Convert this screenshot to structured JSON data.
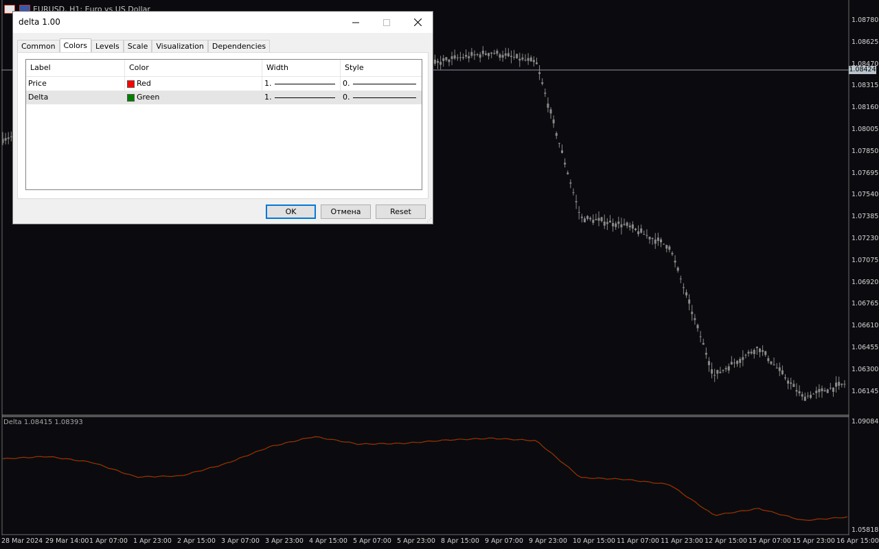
{
  "chart": {
    "symbol_title": "EURUSD, H1:  Euro vs US Dollar",
    "indicator_title": "Delta 1.08415 1.08393",
    "current_price": "1.08424",
    "price_axis": [
      "1.08780",
      "1.08625",
      "1.08470",
      "1.08315",
      "1.08160",
      "1.08005",
      "1.07850",
      "1.07695",
      "1.07540",
      "1.07385",
      "1.07230",
      "1.07075",
      "1.06920",
      "1.06765",
      "1.06610",
      "1.06455",
      "1.06300",
      "1.06145"
    ],
    "indicator_axis": [
      "1.09084",
      "1.05818"
    ],
    "time_axis": [
      "28 Mar 2024",
      "29 Mar 14:00",
      "1 Apr 07:00",
      "1 Apr 23:00",
      "2 Apr 15:00",
      "3 Apr 07:00",
      "3 Apr 23:00",
      "4 Apr 15:00",
      "5 Apr 07:00",
      "5 Apr 23:00",
      "8 Apr 15:00",
      "9 Apr 07:00",
      "9 Apr 23:00",
      "10 Apr 15:00",
      "11 Apr 07:00",
      "11 Apr 23:00",
      "12 Apr 15:00",
      "15 Apr 07:00",
      "15 Apr 23:00",
      "16 Apr 15:00"
    ],
    "colors": {
      "background": "#0b0b0f",
      "candles": "#8a8a8a",
      "price_line": "#ff0000",
      "delta_line": "#008000"
    }
  },
  "chart_data": {
    "type": "line",
    "x": [
      "28 Mar 2024",
      "29 Mar 14:00",
      "1 Apr 07:00",
      "1 Apr 23:00",
      "2 Apr 15:00",
      "3 Apr 07:00",
      "3 Apr 23:00",
      "4 Apr 15:00",
      "5 Apr 07:00",
      "5 Apr 23:00",
      "8 Apr 15:00",
      "9 Apr 07:00",
      "9 Apr 23:00",
      "10 Apr 15:00",
      "11 Apr 07:00",
      "11 Apr 23:00",
      "12 Apr 15:00",
      "15 Apr 07:00",
      "15 Apr 23:00",
      "16 Apr 15:00"
    ],
    "series": [
      {
        "name": "Price",
        "color": "#ff0000",
        "values": [
          1.0795,
          1.0802,
          1.0785,
          1.0742,
          1.0745,
          1.078,
          1.083,
          1.086,
          1.0838,
          1.084,
          1.085,
          1.0855,
          1.0848,
          1.074,
          1.0735,
          1.072,
          1.063,
          1.065,
          1.0615,
          1.0625
        ]
      },
      {
        "name": "Delta",
        "color": "#008000",
        "values": [
          1.0795,
          1.0802,
          1.0785,
          1.0742,
          1.0745,
          1.078,
          1.083,
          1.086,
          1.0838,
          1.084,
          1.085,
          1.0855,
          1.0848,
          1.074,
          1.0735,
          1.072,
          1.063,
          1.065,
          1.0615,
          1.0625
        ]
      }
    ],
    "ylim": [
      1.05818,
      1.09084
    ]
  },
  "dialog": {
    "title": "delta 1.00",
    "tabs": [
      "Common",
      "Colors",
      "Levels",
      "Scale",
      "Visualization",
      "Dependencies"
    ],
    "active_tab": "Colors",
    "columns": [
      "Label",
      "Color",
      "Width",
      "Style"
    ],
    "rows": [
      {
        "label": "Price",
        "color_name": "Red",
        "color": "#ff0000",
        "width": "1.",
        "style": "0."
      },
      {
        "label": "Delta",
        "color_name": "Green",
        "color": "#008000",
        "width": "1.",
        "style": "0."
      }
    ],
    "buttons": {
      "ok": "OK",
      "cancel": "Отмена",
      "reset": "Reset"
    }
  }
}
